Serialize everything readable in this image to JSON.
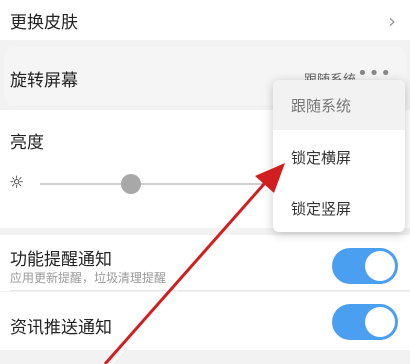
{
  "settings": {
    "skin": {
      "label": "更换皮肤"
    },
    "rotate": {
      "label": "旋转屏幕",
      "value": "跟随系统"
    },
    "brightness": {
      "label": "亮度",
      "level": 0.4
    },
    "function_alert": {
      "label": "功能提醒通知",
      "desc": "应用更新提醒，垃圾清理提醒",
      "enabled": true
    },
    "news_push": {
      "label": "资讯推送通知",
      "enabled": true
    }
  },
  "dropdown": {
    "options": [
      "跟随系统",
      "锁定横屏",
      "锁定竖屏"
    ],
    "selected": "跟随系统"
  },
  "colors": {
    "toggle_on": "#4a9ff0",
    "annotation_arrow": "#d11f1f"
  }
}
